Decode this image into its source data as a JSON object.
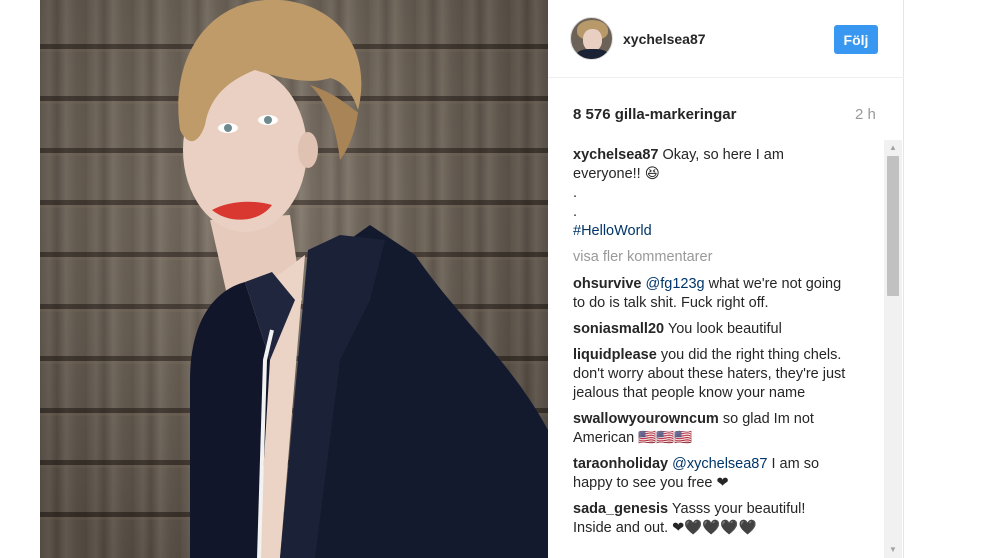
{
  "post": {
    "username": "xychelsea87",
    "follow_label": "Följ",
    "likes": "8 576 gilla-markeringar",
    "time_ago": "2 h"
  },
  "caption": {
    "user": "xychelsea87",
    "text": "Okay, so here I am everyone!! 😆",
    "line2": ".",
    "line3": ".",
    "hashtag": "#HelloWorld"
  },
  "load_more_label": "visa fler kommentarer",
  "comments": [
    {
      "user": "ohsurvive",
      "mention": "@fg123g",
      "text": "what we're not going to do is talk shit. Fuck right off."
    },
    {
      "user": "soniasmall20",
      "mention": "",
      "text": "You look beautiful"
    },
    {
      "user": "liquidplease",
      "mention": "",
      "text": "you did the right thing chels. don't worry about these haters, they're just jealous that people know your name"
    },
    {
      "user": "swallowyourowncum",
      "mention": "",
      "text": "so glad Im not American 🇺🇸🇺🇸🇺🇸"
    },
    {
      "user": "taraonholiday",
      "mention": "@xychelsea87",
      "text": "I am so happy to see you free ❤"
    },
    {
      "user": "sada_genesis",
      "mention": "",
      "text": "Yasss your beautiful! Inside and out. ❤🖤🖤🖤🖤"
    }
  ],
  "icons": {
    "scroll_up": "▲",
    "scroll_down": "▼"
  },
  "colors": {
    "follow_button": "#3897f0",
    "hashtag": "#003569",
    "muted": "#999999"
  }
}
